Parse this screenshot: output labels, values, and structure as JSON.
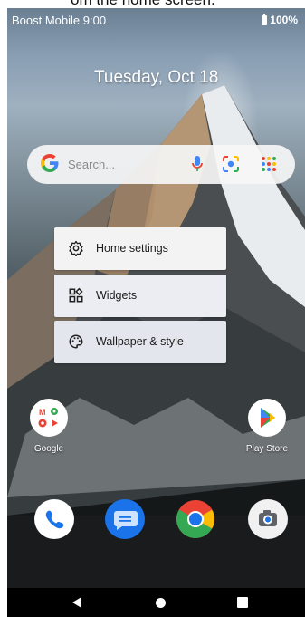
{
  "caption": {
    "text": "om the home screen."
  },
  "status_bar": {
    "carrier_time": "Boost Mobile 9:00",
    "battery": "100%"
  },
  "clock": {
    "date": "Tuesday, Oct 18"
  },
  "search": {
    "placeholder": "Search..."
  },
  "menu": {
    "items": [
      {
        "label": "Home settings",
        "icon": "gear-icon"
      },
      {
        "label": "Widgets",
        "icon": "widgets-icon"
      },
      {
        "label": "Wallpaper & style",
        "icon": "palette-icon"
      }
    ]
  },
  "apps": {
    "google": "Google",
    "play_store": "Play Store"
  },
  "dock": [
    "phone-icon",
    "messages-icon",
    "chrome-icon",
    "camera-icon"
  ],
  "nav": [
    "back-icon",
    "home-icon",
    "recents-icon"
  ]
}
